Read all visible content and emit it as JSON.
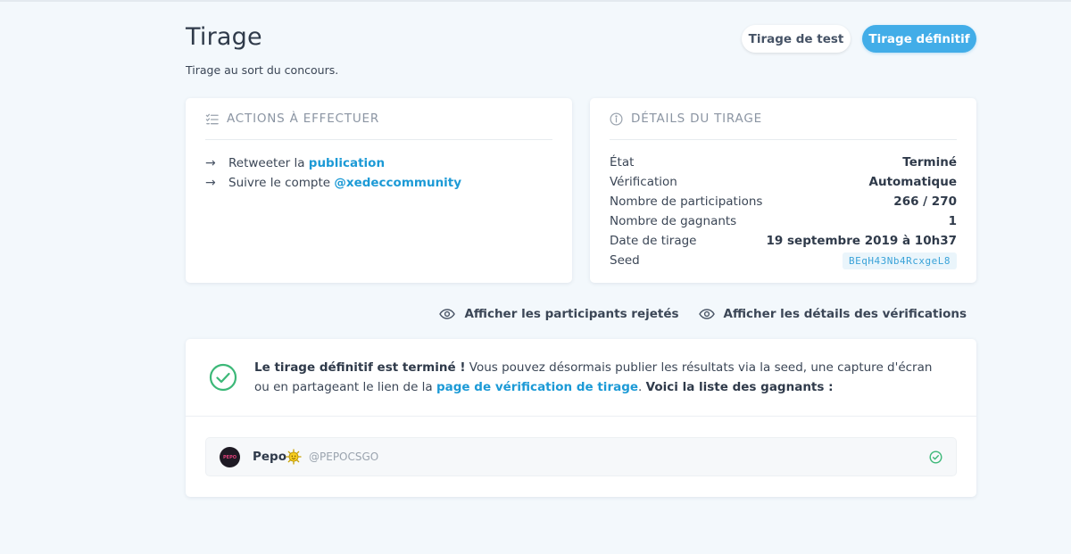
{
  "header": {
    "title": "Tirage",
    "subtitle": "Tirage au sort du concours.",
    "test_button": "Tirage de test",
    "final_button": "Tirage définitif"
  },
  "actions_card": {
    "title": "ACTIONS À EFFECTUER",
    "items": [
      {
        "prefix": "Retweeter la ",
        "link": "publication"
      },
      {
        "prefix": "Suivre le compte ",
        "link": "@xedeccommunity"
      }
    ]
  },
  "details_card": {
    "title": "DÉTAILS DU TIRAGE",
    "rows": [
      {
        "label": "État",
        "value": "Terminé"
      },
      {
        "label": "Vérification",
        "value": "Automatique"
      },
      {
        "label": "Nombre de participations",
        "value": "266 / 270"
      },
      {
        "label": "Nombre de gagnants",
        "value": "1"
      },
      {
        "label": "Date de tirage",
        "value": "19 septembre 2019 à 10h37"
      },
      {
        "label": "Seed",
        "value": "BEqH43Nb4RcxgeL8"
      }
    ]
  },
  "links": {
    "rejected": "Afficher les participants rejetés",
    "verifications": "Afficher les détails des vérifications"
  },
  "result": {
    "bold_intro": "Le tirage définitif est terminé !",
    "text_before_link": " Vous pouvez désormais publier les résultats via la seed, une capture d'écran ou en partageant le lien de la ",
    "link": "page de vérification de tirage",
    "text_after_link": ". ",
    "bold_outro": "Voici la liste des gagnants :"
  },
  "winners": [
    {
      "name": "Pepo",
      "handle": "@PEPOCSGO",
      "avatar_text": "PEPO"
    }
  ],
  "colors": {
    "accent": "#42ade8",
    "link": "#1c9ad6",
    "success": "#3cb878",
    "background": "#f3f8fc"
  }
}
